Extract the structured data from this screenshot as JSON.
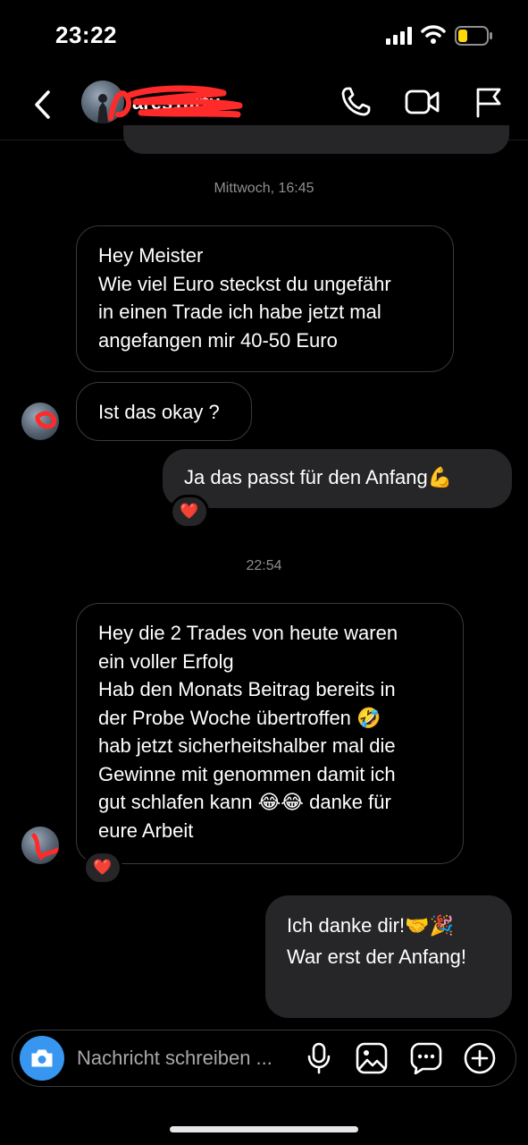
{
  "status_bar": {
    "time": "23:22"
  },
  "header": {
    "username": "ares1artu"
  },
  "timestamps": [
    "Mittwoch, 16:45",
    "22:54"
  ],
  "messages": [
    {
      "direction": "incoming",
      "lines": [
        "Hey Meister",
        "Wie viel Euro steckst du ungefähr",
        "in einen Trade ich habe jetzt mal",
        "angefangen mir 40-50 Euro"
      ]
    },
    {
      "direction": "incoming",
      "lines": [
        "Ist das okay ?"
      ]
    },
    {
      "direction": "outgoing",
      "lines": [
        "Ja das passt für den Anfang💪"
      ],
      "reaction": "❤️"
    },
    {
      "direction": "incoming",
      "lines": [
        "Hey die 2 Trades von heute waren",
        "ein voller Erfolg",
        "Hab den Monats Beitrag bereits in",
        "der Probe Woche übertroffen 🤣",
        "hab jetzt sicherheitshalber mal die",
        "Gewinne mit genommen damit ich",
        "gut schlafen kann 😂😂 danke für",
        "eure Arbeit"
      ],
      "reaction": "❤️"
    },
    {
      "direction": "outgoing",
      "lines": [
        "Ich danke dir!🤝🎉",
        "",
        "War erst der Anfang!"
      ]
    }
  ],
  "composer": {
    "placeholder": "Nachricht schreiben ..."
  },
  "colors": {
    "accent": "#3797f0",
    "outgoing_bubble": "#262628",
    "incoming_border": "#3a3a3c",
    "redaction": "#ff2a2a"
  }
}
